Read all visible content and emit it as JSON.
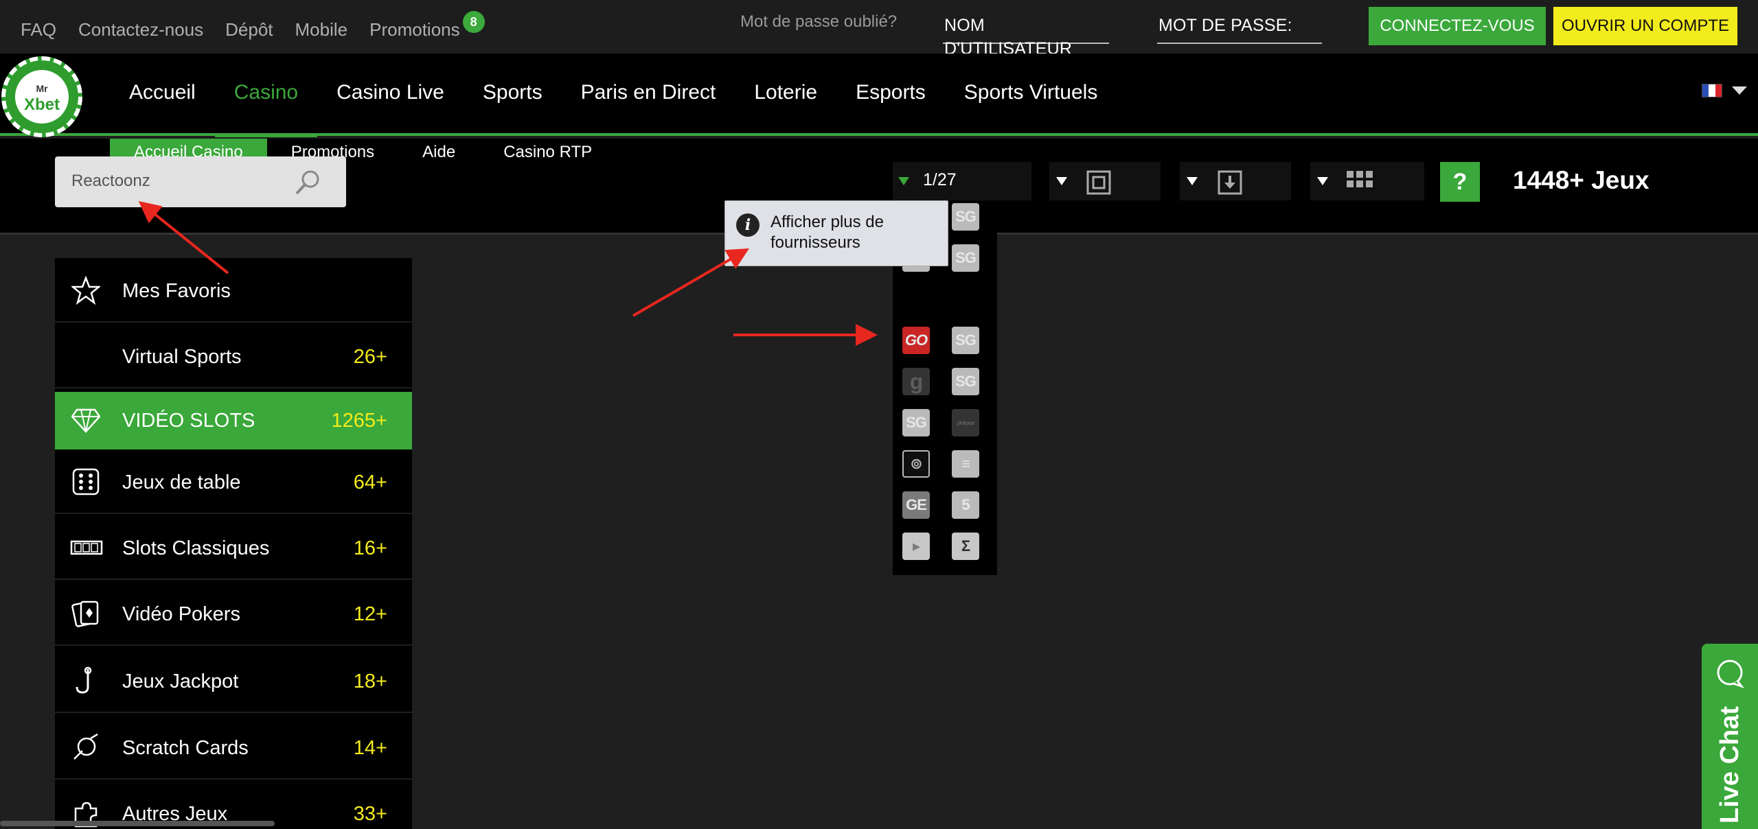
{
  "topbar": {
    "links": [
      {
        "label": "FAQ"
      },
      {
        "label": "Contactez-nous"
      },
      {
        "label": "Dépôt"
      },
      {
        "label": "Mobile"
      },
      {
        "label": "Promotions"
      }
    ],
    "promotions_badge": "8",
    "forgot_password": "Mot de passe oublié?",
    "username_placeholder": "NOM D'UTILISATEUR",
    "password_label": "MOT DE PASSE:",
    "login_button": "CONNECTEZ-VOUS",
    "open_account_button": "OUVRIR UN COMPTE"
  },
  "logo": {
    "mr": "Mr",
    "brand": "Xbet"
  },
  "mainnav": {
    "items": [
      {
        "label": "Accueil"
      },
      {
        "label": "Casino"
      },
      {
        "label": "Casino Live"
      },
      {
        "label": "Sports"
      },
      {
        "label": "Paris en Direct"
      },
      {
        "label": "Loterie"
      },
      {
        "label": "Esports"
      },
      {
        "label": "Sports Virtuels"
      }
    ],
    "active": "Casino"
  },
  "subnav": {
    "items": [
      {
        "label": "Accueil Casino"
      },
      {
        "label": "Promotions"
      },
      {
        "label": "Aide"
      },
      {
        "label": "Casino RTP"
      }
    ],
    "active": "Accueil Casino"
  },
  "search": {
    "value": "Reactoonz"
  },
  "toolbar": {
    "page": "1/27",
    "help": "?",
    "games_count": "1448+ Jeux"
  },
  "tooltip": {
    "text": "Afficher plus de fournisseurs"
  },
  "providers": [
    {
      "label": "SG"
    },
    {
      "label": "SG"
    },
    {
      "label": "SG"
    },
    {
      "label": "SG"
    },
    {
      "label": "GO"
    },
    {
      "label": "SG"
    },
    {
      "label": "g"
    },
    {
      "label": "SG"
    },
    {
      "label": "SG"
    },
    {
      "label": "pinkpear"
    },
    {
      "label": "⊚"
    },
    {
      "label": "≡"
    },
    {
      "label": "GE"
    },
    {
      "label": "5"
    },
    {
      "label": "▸"
    },
    {
      "label": "Σ"
    }
  ],
  "sidebar": {
    "items": [
      {
        "label": "Mes Favoris",
        "count": ""
      },
      {
        "label": "Virtual Sports",
        "count": "26+"
      },
      {
        "label": "VIDÉO SLOTS",
        "count": "1265+"
      },
      {
        "label": "Jeux de table",
        "count": "64+"
      },
      {
        "label": "Slots Classiques",
        "count": "16+"
      },
      {
        "label": "Vidéo Pokers",
        "count": "12+"
      },
      {
        "label": "Jeux Jackpot",
        "count": "18+"
      },
      {
        "label": "Scratch Cards",
        "count": "14+"
      },
      {
        "label": "Autres Jeux",
        "count": "33+"
      }
    ],
    "active": "VIDÉO SLOTS"
  },
  "livechat": {
    "label": "Live Chat"
  },
  "colors": {
    "accent_green": "#3aa83a",
    "accent_yellow": "#f3ec1d",
    "annotation_red": "#e8271f"
  }
}
